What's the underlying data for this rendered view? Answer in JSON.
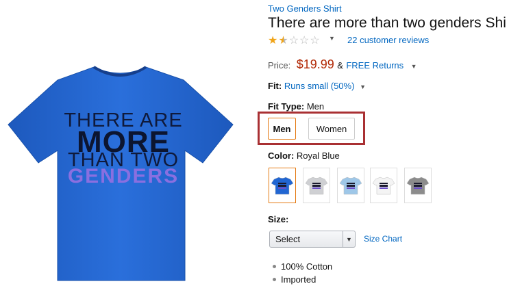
{
  "product": {
    "brand": "Two Genders Shirt",
    "title": "There are more than two genders Shi",
    "shirt_print": {
      "line1": "THERE ARE",
      "line2": "MORE",
      "line3": "THAN TWO",
      "line4": "GENDERS"
    },
    "shirt_color": "#2166d2"
  },
  "rating": {
    "stars": 1.5,
    "max_stars": 5,
    "full_glyph": "★",
    "empty_glyph": "☆",
    "reviews_label": "22 customer reviews"
  },
  "price": {
    "label": "Price:",
    "value": "$19.99",
    "amp": "&",
    "returns_label": "FREE Returns"
  },
  "fit": {
    "label": "Fit:",
    "value": "Runs small (50%)"
  },
  "fit_type": {
    "label": "Fit Type:",
    "selected": "Men",
    "options": [
      "Men",
      "Women"
    ]
  },
  "color": {
    "label": "Color:",
    "selected": "Royal Blue",
    "swatches": [
      {
        "name": "Royal Blue",
        "hex": "#2166d2",
        "selected": true
      },
      {
        "name": "Silver",
        "hex": "#cfd0d3",
        "selected": false
      },
      {
        "name": "Light Blue",
        "hex": "#9ec7e8",
        "selected": false
      },
      {
        "name": "White",
        "hex": "#f4f4f4",
        "selected": false
      },
      {
        "name": "Gray",
        "hex": "#8c8c8c",
        "selected": false
      }
    ]
  },
  "size": {
    "label": "Size:",
    "select_value": "Select",
    "chart_link": "Size Chart"
  },
  "features": [
    "100% Cotton",
    "Imported"
  ],
  "colors": {
    "link": "#0066c0",
    "price": "#b12704",
    "highlight_border": "#a93033",
    "selected_border": "#e47911"
  }
}
